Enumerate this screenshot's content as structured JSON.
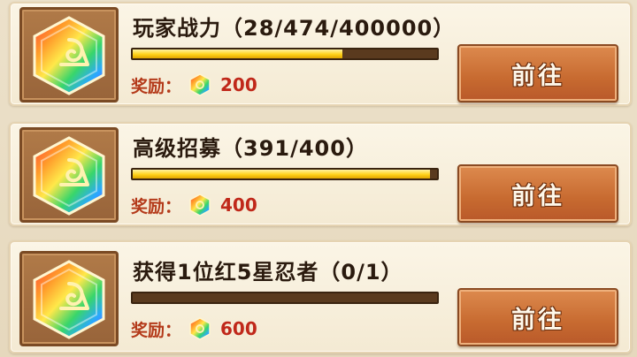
{
  "tasks": [
    {
      "title": "玩家战力（28/474/400000）",
      "progress": 0.69,
      "reward_label": "奖励：",
      "reward_icon": "rainbow-gem-icon",
      "reward_amount": "200",
      "button_label": "前往"
    },
    {
      "title": "高级招募（391/400）",
      "progress": 0.978,
      "reward_label": "奖励：",
      "reward_icon": "rainbow-gem-icon",
      "reward_amount": "400",
      "button_label": "前往"
    },
    {
      "title": "获得1位红5星忍者（0/1）",
      "progress": 0,
      "reward_label": "奖励：",
      "reward_icon": "rainbow-gem-icon",
      "reward_amount": "600",
      "button_label": "前往"
    }
  ],
  "colors": {
    "bar_fill": "#ffd21a",
    "reward_text": "#c0281a",
    "button": "#c76a30"
  }
}
